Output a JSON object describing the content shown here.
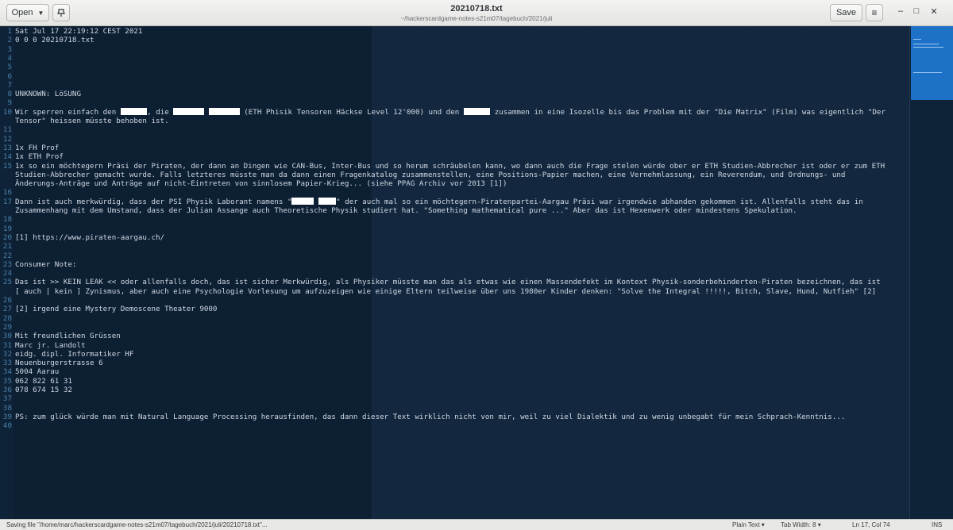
{
  "header": {
    "open_label": "Open",
    "title": "20210718.txt",
    "path": "~/hackerscardgame-notes-s21m07/tagebuch/2021/juli",
    "save_label": "Save",
    "minimize_glyph": "–",
    "maximize_glyph": "□",
    "close_glyph": "✕"
  },
  "icons": {
    "open_dropdown": "chevron-down-icon",
    "pin": "document-pin-icon",
    "menu": "hamburger-menu-icon"
  },
  "editor": {
    "lines": [
      {
        "n": "1",
        "segs": [
          {
            "t": "Sat Jul 17 22:19:12 CEST 2021"
          }
        ]
      },
      {
        "n": "2",
        "segs": [
          {
            "t": "0 0 0 20210718.txt"
          }
        ]
      },
      {
        "n": "3",
        "segs": []
      },
      {
        "n": "4",
        "segs": []
      },
      {
        "n": "5",
        "segs": []
      },
      {
        "n": "6",
        "segs": []
      },
      {
        "n": "7",
        "segs": []
      },
      {
        "n": "8",
        "segs": [
          {
            "t": "UNKNOWN: LöSUNG"
          }
        ]
      },
      {
        "n": "9",
        "segs": []
      },
      {
        "n": "10",
        "segs": [
          {
            "t": "Wir sperren einfach den "
          },
          {
            "r": 6
          },
          {
            "t": ", die "
          },
          {
            "r": 7
          },
          {
            "t": " "
          },
          {
            "r": 7
          },
          {
            "t": " (ETH Phisik Tensoren Häckse Level 12'000) und den "
          },
          {
            "r": 6
          },
          {
            "t": " zusammen in eine Isozelle bis das Problem mit der \"Die Matrix\" (Film) was eigentlich \"Der"
          }
        ]
      },
      {
        "n": "",
        "segs": [
          {
            "t": "Tensor\" heissen müsste behoben ist."
          }
        ]
      },
      {
        "n": "11",
        "segs": []
      },
      {
        "n": "12",
        "segs": []
      },
      {
        "n": "13",
        "segs": [
          {
            "t": "1x FH Prof"
          }
        ]
      },
      {
        "n": "14",
        "segs": [
          {
            "t": "1x ETH Prof"
          }
        ]
      },
      {
        "n": "15",
        "segs": [
          {
            "t": "1x so ein möchtegern Präsi der Piraten, der dann an Dingen wie CAN-Bus, Inter-Bus und so herum schräubelen kann, wo dann auch die Frage stelen würde ober er ETH Studien-Abbrecher ist oder er zum ETH"
          }
        ]
      },
      {
        "n": "",
        "segs": [
          {
            "t": "Studien-Abbrecher gemacht wurde. Falls letzteres müsste man da dann einen Fragenkatalog zusammenstellen, eine Positions-Papier machen, eine Vernehmlassung, ein Reverendum, und Ordnungs- und"
          }
        ]
      },
      {
        "n": "",
        "segs": [
          {
            "t": "Änderungs-Anträge und Anträge auf nicht-Eintreten von sinnlosem Papier-Krieg... (siehe PPAG Archiv vor 2013 [1])"
          }
        ]
      },
      {
        "n": "16",
        "segs": []
      },
      {
        "n": "17",
        "segs": [
          {
            "t": "Dann ist auch merkwürdig, dass der PSI Physik Laborant namens \""
          },
          {
            "r": 5
          },
          {
            "t": " "
          },
          {
            "r": 4
          },
          {
            "t": "\" der auch mal so ein möchtegern-Piratenpartei-Aargau Präsi war irgendwie abhanden gekommen ist. Allenfalls steht das in"
          }
        ]
      },
      {
        "n": "",
        "segs": [
          {
            "t": "Zusammenhang mit dem Umstand, dass der Julian Assange auch Theoretische Physik studiert hat. \"Something mathematical pure ...\" Aber das ist Hexenwerk oder mindestens Spekulation."
          }
        ]
      },
      {
        "n": "18",
        "segs": []
      },
      {
        "n": "19",
        "segs": []
      },
      {
        "n": "20",
        "segs": [
          {
            "t": "[1] https://www.piraten-aargau.ch/"
          }
        ]
      },
      {
        "n": "21",
        "segs": []
      },
      {
        "n": "22",
        "segs": []
      },
      {
        "n": "23",
        "segs": [
          {
            "t": "Consumer Note:"
          }
        ]
      },
      {
        "n": "24",
        "segs": []
      },
      {
        "n": "25",
        "segs": [
          {
            "t": "Das ist >> KEIN LEAK << oder allenfalls doch, das ist sicher Merkwürdig, als Physiker müsste man das als etwas wie einen Massendefekt im Kontext Physik-sonderbehinderten-Piraten bezeichnen, das ist"
          }
        ]
      },
      {
        "n": "",
        "segs": [
          {
            "t": "[ auch | kein ] Zynismus, aber auch eine Psychologie Vorlesung um aufzuzeigen wie einige Eltern teilweise über uns 1980er Kinder denken: \"Solve the Integral !!!!!, Bitch, Slave, Hund, Nutfieh\" [2]"
          }
        ]
      },
      {
        "n": "26",
        "segs": []
      },
      {
        "n": "27",
        "segs": [
          {
            "t": "[2] irgend eine Mystery Demoscene Theater 9000"
          }
        ]
      },
      {
        "n": "28",
        "segs": []
      },
      {
        "n": "29",
        "segs": []
      },
      {
        "n": "30",
        "segs": [
          {
            "t": "Mit freundlichen Grüssen"
          }
        ]
      },
      {
        "n": "31",
        "segs": [
          {
            "t": "Marc jr. Landolt"
          }
        ]
      },
      {
        "n": "32",
        "segs": [
          {
            "t": "eidg. dipl. Informatiker HF"
          }
        ]
      },
      {
        "n": "33",
        "segs": [
          {
            "t": "Neuenburgerstrasse 6"
          }
        ]
      },
      {
        "n": "34",
        "segs": [
          {
            "t": "5004 Aarau"
          }
        ]
      },
      {
        "n": "35",
        "segs": [
          {
            "t": "062 822 61 31"
          }
        ]
      },
      {
        "n": "36",
        "segs": [
          {
            "t": "078 674 15 32"
          }
        ]
      },
      {
        "n": "37",
        "segs": []
      },
      {
        "n": "38",
        "segs": []
      },
      {
        "n": "39",
        "segs": [
          {
            "t": "PS: zum glück würde man mit Natural Language Processing herausfinden, das dann dieser Text wirklich nicht von mir, weil zu viel Dialektik und zu wenig unbegabt für mein Schprach-Kenntnis..."
          }
        ]
      },
      {
        "n": "40",
        "segs": []
      }
    ]
  },
  "statusbar": {
    "message": "Saving file \"/home/marc/hackerscardgame-notes-s21m07/tagebuch/2021/juli/20210718.txt\"...",
    "language": "Plain Text",
    "tab_width": "Tab Width: 8",
    "cursor": "Ln 17, Col 74",
    "mode": "INS"
  },
  "colors": {
    "editor_bg": "#0d1f33",
    "text": "#cfd8e3",
    "line_numbers": "#4a7fa8",
    "minimap_view": "#1d72c8"
  }
}
